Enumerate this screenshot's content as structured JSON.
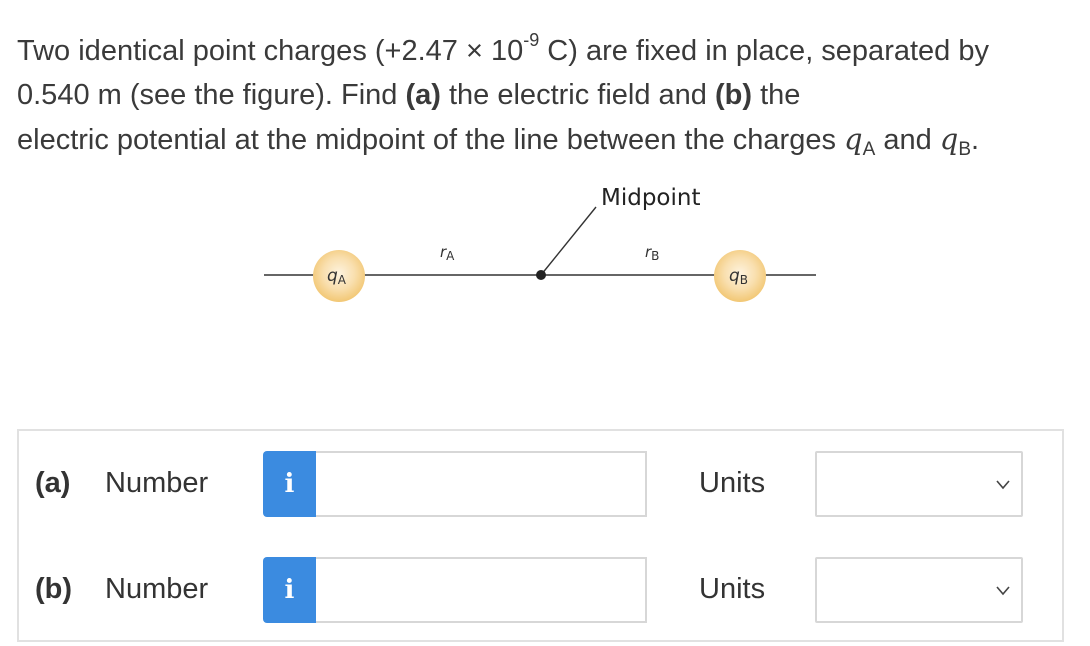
{
  "problem": {
    "line1_a": "Two identical point charges (+2.47 × 10",
    "line1_exp": "-9",
    "line1_b": " C) are fixed in place, separated by",
    "line2_a": "0.540 m (see the figure). Find ",
    "line2_bold_a": "(a)",
    "line2_b": " the electric field and ",
    "line2_bold_b": "(b)",
    "line2_c": " the",
    "line3_a": "electric potential at the midpoint of the line between the charges ",
    "q_sym": "q",
    "sub_a": "A",
    "line3_and": " and ",
    "sub_b": "B",
    "line3_end": "."
  },
  "figure": {
    "midpoint_label": "Midpoint",
    "charge_a_label": "q",
    "charge_a_sub": "A",
    "charge_b_label": "q",
    "charge_b_sub": "B",
    "ra_label": "r",
    "ra_sub": "A",
    "rb_label": "r",
    "rb_sub": "B",
    "colors": {
      "charge_fill": "#f7d79a",
      "charge_glow": "#fbe9c8",
      "line": "#333333"
    }
  },
  "answers": {
    "part_a": {
      "part_label": "(a)",
      "number_label": "Number",
      "info_icon_text": "i",
      "value": "",
      "units_label": "Units",
      "units_value": ""
    },
    "part_b": {
      "part_label": "(b)",
      "number_label": "Number",
      "info_icon_text": "i",
      "value": "",
      "units_label": "Units",
      "units_value": ""
    }
  },
  "colors": {
    "info_button": "#3b8be0",
    "border": "#d7d7d7",
    "panel_border": "#e1e1e1"
  }
}
